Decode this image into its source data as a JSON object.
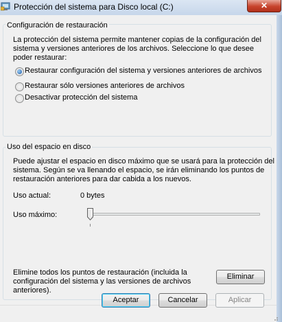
{
  "window": {
    "title": "Protección del sistema para Disco local (C:)",
    "close_glyph": "✕"
  },
  "restore_group": {
    "title": "Configuración de restauración",
    "description": [
      "La protección del sistema permite mantener copias de la configuración del",
      "sistema y versiones anteriores de los archivos. Seleccione lo que desee",
      "poder restaurar:"
    ],
    "options": [
      {
        "label": "Restaurar configuración del sistema y versiones anteriores de archivos",
        "selected": true
      },
      {
        "label": "Restaurar sólo versiones anteriores de archivos",
        "selected": false
      },
      {
        "label": "Desactivar protección del sistema",
        "selected": false
      }
    ]
  },
  "disk_group": {
    "title": "Uso del espacio en disco",
    "description": [
      "Puede ajustar el espacio en disco máximo que se usará para la protección del",
      "sistema. Según se va llenando el espacio, se irán eliminando los puntos de",
      "restauración anteriores para dar cabida a los nuevos."
    ],
    "current_usage_label": "Uso actual:",
    "current_usage_value": "0 bytes",
    "max_usage_label": "Uso máximo:",
    "max_usage_fraction": 0.0,
    "delete_text": [
      "Elimine todos los puntos de restauración (incluida la",
      "configuración del sistema y las versiones de archivos",
      "anteriores)."
    ],
    "delete_button": "Eliminar"
  },
  "footer": {
    "ok": "Aceptar",
    "cancel": "Cancelar",
    "apply": "Aplicar"
  },
  "icons": {
    "app": "system-protection-icon",
    "close": "close-icon",
    "gripper": "resize-gripper-icon"
  }
}
